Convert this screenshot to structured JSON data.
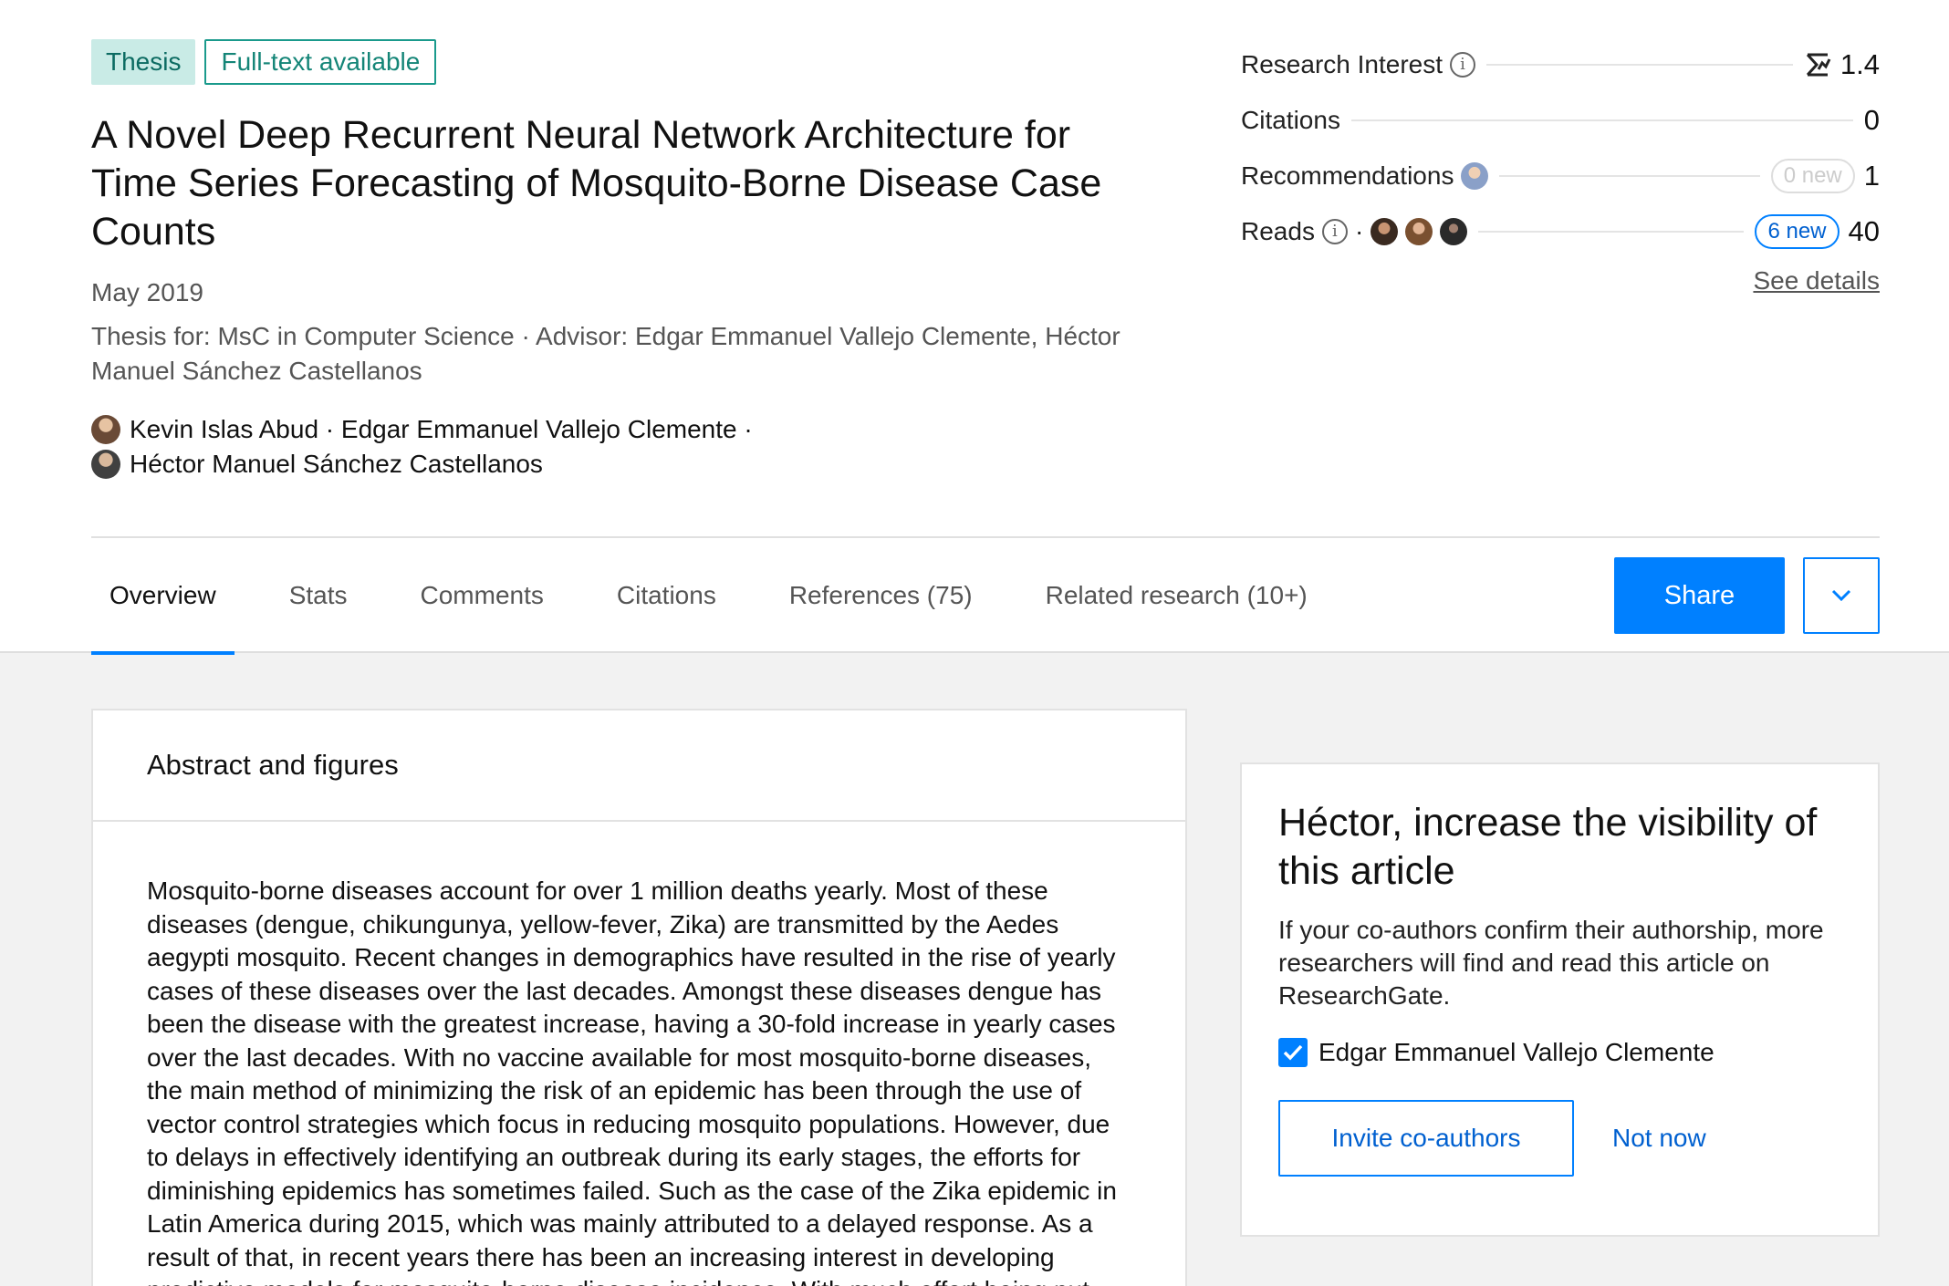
{
  "badges": {
    "type": "Thesis",
    "availability": "Full-text available"
  },
  "publication": {
    "title": "A Novel Deep Recurrent Neural Network Architecture for Time Series Forecasting of Mosquito-Borne Disease Case Counts",
    "date": "May 2019",
    "thesis_info": "Thesis for: MsC in Computer Science · Advisor: Edgar Emmanuel Vallejo Clemente, Héctor Manuel Sánchez Castellanos",
    "authors_line1": "Kevin Islas Abud · Edgar Emmanuel Vallejo Clemente ·",
    "authors_line2": "Héctor Manuel Sánchez Castellanos"
  },
  "stats": {
    "research_interest": {
      "label": "Research Interest",
      "value": "1.4"
    },
    "citations": {
      "label": "Citations",
      "value": "0"
    },
    "recommendations": {
      "label": "Recommendations",
      "new": "0 new",
      "value": "1"
    },
    "reads": {
      "label": "Reads",
      "new": "6 new",
      "value": "40"
    },
    "see_details": "See details"
  },
  "tabs": [
    {
      "label": "Overview",
      "active": true
    },
    {
      "label": "Stats"
    },
    {
      "label": "Comments"
    },
    {
      "label": "Citations"
    },
    {
      "label": "References (75)"
    },
    {
      "label": "Related research (10+)"
    }
  ],
  "actions": {
    "share": "Share"
  },
  "abstract": {
    "heading": "Abstract and figures",
    "text": "Mosquito-borne diseases account for over 1 million deaths yearly. Most of these diseases (dengue, chikungunya, yellow-fever, Zika) are transmitted by the Aedes aegypti mosquito. Recent changes in demographics have resulted in the rise of yearly cases of these diseases over the last decades. Amongst these diseases dengue has been the disease with the greatest increase, having a 30-fold increase in yearly cases over the last decades. With no vaccine available for most mosquito-borne diseases, the main method of minimizing the risk of an epidemic has been through the use of vector control strategies which focus in reducing mosquito populations. However, due to delays in effectively identifying an outbreak during its early stages, the efforts for diminishing epidemics has sometimes failed. Such as the case of the Zika epidemic in Latin America during 2015, which was mainly attributed to a delayed response. As a result of that, in recent years there has been an increasing interest in developing predictive models for mosquito-borne disease incidence. With much effort being put"
  },
  "visibility": {
    "title": "Héctor, increase the visibility of this article",
    "body": "If your co-authors confirm their authorship, more researchers will find and read this article on ResearchGate.",
    "coauthor": "Edgar Emmanuel Vallejo Clemente",
    "invite": "Invite co-authors",
    "not_now": "Not now"
  },
  "colors": {
    "accent": "#0080ff",
    "thesis_bg": "#c9ebe6",
    "teal": "#1a9a8c"
  }
}
